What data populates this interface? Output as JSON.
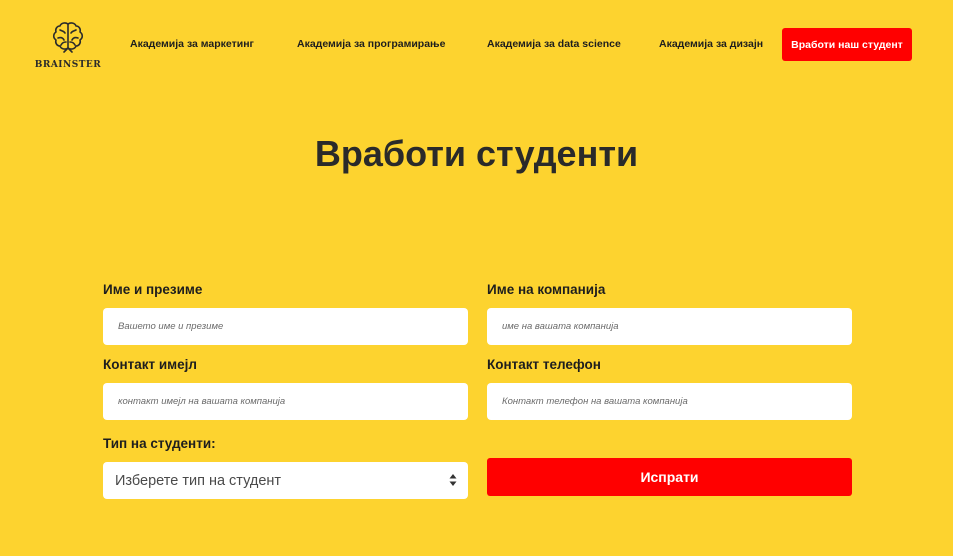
{
  "nav": {
    "logo_text": "BRAINSTER",
    "links": [
      "Академија за маркетинг",
      "Академија за програмирање",
      "Академија за data science",
      "Академија за дизајн"
    ],
    "cta_label": "Вработи наш студент"
  },
  "page": {
    "title": "Вработи студенти"
  },
  "form": {
    "name": {
      "label": "Име и презиме",
      "placeholder": "Вашето име и презиме",
      "value": ""
    },
    "company": {
      "label": "Име на компанија",
      "placeholder": "име на вашата компанија",
      "value": ""
    },
    "email": {
      "label": "Контакт имејл",
      "placeholder": "контакт имејл на вашата компанија",
      "value": ""
    },
    "phone": {
      "label": "Контакт телефон",
      "placeholder": "Контакт телефон на вашата компанија",
      "value": ""
    },
    "student_type": {
      "label": "Тип на студенти:",
      "selected": "Изберете тип на студент"
    },
    "submit_label": "Испрати"
  },
  "colors": {
    "background": "#fdd32f",
    "accent": "#ff0000",
    "text": "#1e1e1e"
  },
  "icons": {
    "logo": "brain-icon",
    "select": "select-arrows-icon"
  }
}
